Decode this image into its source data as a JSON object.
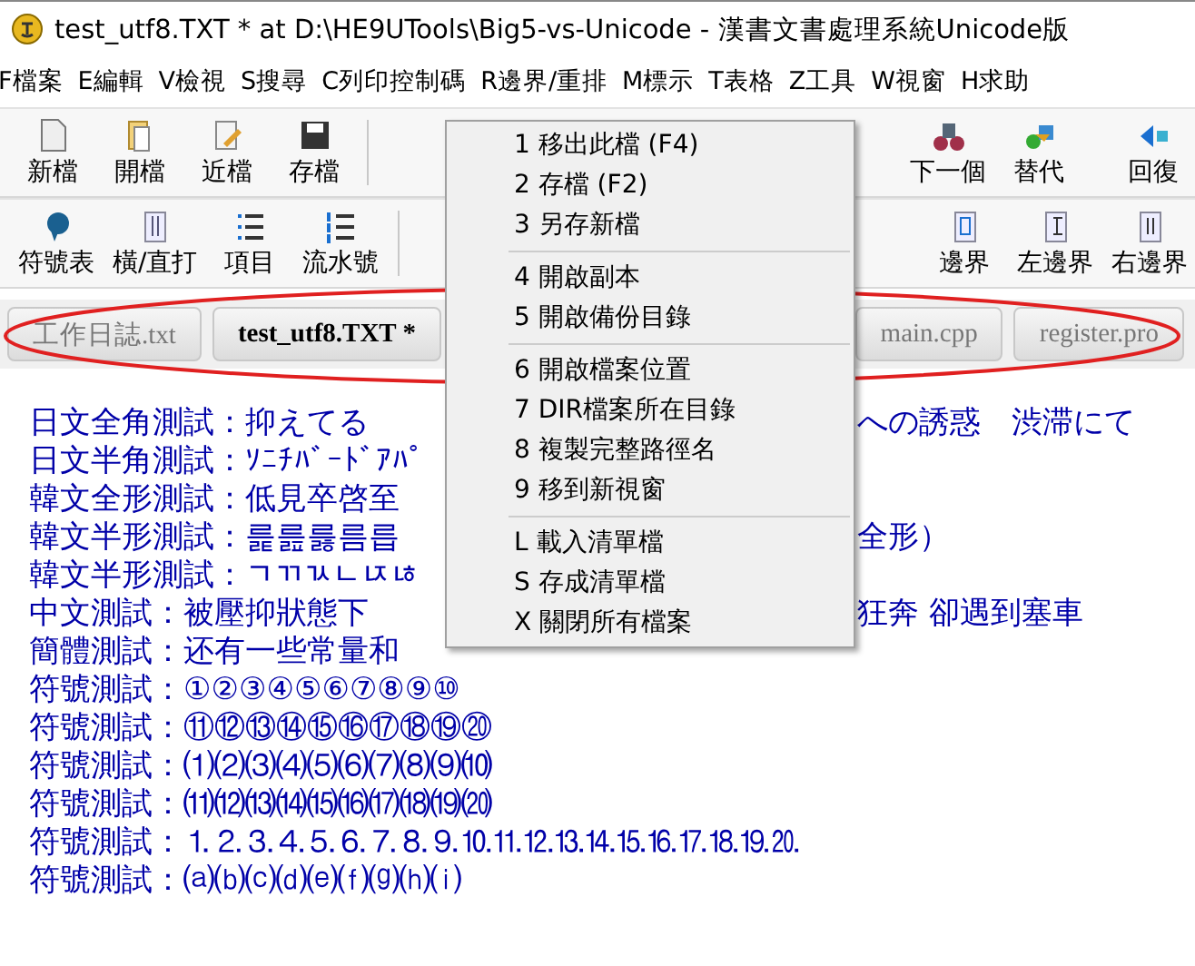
{
  "window": {
    "title": "test_utf8.TXT * at D:\\HE9UTools\\Big5-vs-Unicode - 漢書文書處理系統Unicode版"
  },
  "menu_bar": [
    "F檔案",
    "E編輯",
    "V檢視",
    "S搜尋",
    "C列印控制碼",
    "R邊界/重排",
    "M標示",
    "T表格",
    "Z工具",
    "W視窗",
    "H求助"
  ],
  "toolbar_1": {
    "left": [
      "新檔",
      "開檔",
      "近檔",
      "存檔"
    ],
    "right": [
      "下一個",
      "替代",
      "回復"
    ]
  },
  "toolbar_2": {
    "left": [
      "符號表",
      "橫/直打",
      "項目",
      "流水號"
    ],
    "right": [
      "邊界",
      "左邊界",
      "右邊界"
    ]
  },
  "tabs": {
    "left": [
      {
        "label": "工作日誌.txt",
        "selected": false
      },
      {
        "label": "test_utf8.TXT *",
        "selected": true
      }
    ],
    "right": [
      {
        "label": "main.cpp",
        "selected": false
      },
      {
        "label": "register.pro",
        "selected": false
      }
    ]
  },
  "lines": [
    {
      "left": "日文全角測試：抑えてる",
      "right": "への誘惑　渋滞にて"
    },
    {
      "left": "日文半角測試：ｿﾆﾁﾊﾞｰﾄﾞｱﾊﾟ"
    },
    {
      "left": "韓文全形測試：低見卒啓至"
    },
    {
      "left": "韓文半形測試：릁릂릃름릅",
      "right": "全形）"
    },
    {
      "left": "韓文半形測試：ﾡﾢﾣﾤﾥﾦ"
    },
    {
      "left": "中文測試：被壓抑狀態下",
      "right": "狂奔 卻遇到塞車"
    },
    {
      "left": "簡體測試：还有一些常量和"
    },
    {
      "left": "符號測試：①②③④⑤⑥⑦⑧⑨⑩"
    },
    {
      "left": "符號測試：⑪⑫⑬⑭⑮⑯⑰⑱⑲⑳"
    },
    {
      "left": "符號測試：⑴⑵⑶⑷⑸⑹⑺⑻⑼⑽"
    },
    {
      "left": "符號測試：⑾⑿⒀⒁⒂⒃⒄⒅⒆⒇"
    },
    {
      "left": "符號測試：⒈⒉⒊⒋⒌⒍⒎⒏⒐⒑⒒⒓⒔⒕⒖⒗⒘⒙⒚⒛"
    },
    {
      "left": "符號測試：⒜⒝⒞⒟⒠⒡⒢⒣⒤"
    }
  ],
  "context_menu": [
    [
      "1 移出此檔 (F4)",
      "2 存檔 (F2)",
      "3 另存新檔"
    ],
    [
      "4 開啟副本",
      "5 開啟備份目錄"
    ],
    [
      "6 開啟檔案位置",
      "7 DIR檔案所在目錄",
      "8 複製完整路徑名",
      "9 移到新視窗"
    ],
    [
      "L 載入清單檔",
      "S 存成清單檔",
      "X 關閉所有檔案"
    ]
  ]
}
